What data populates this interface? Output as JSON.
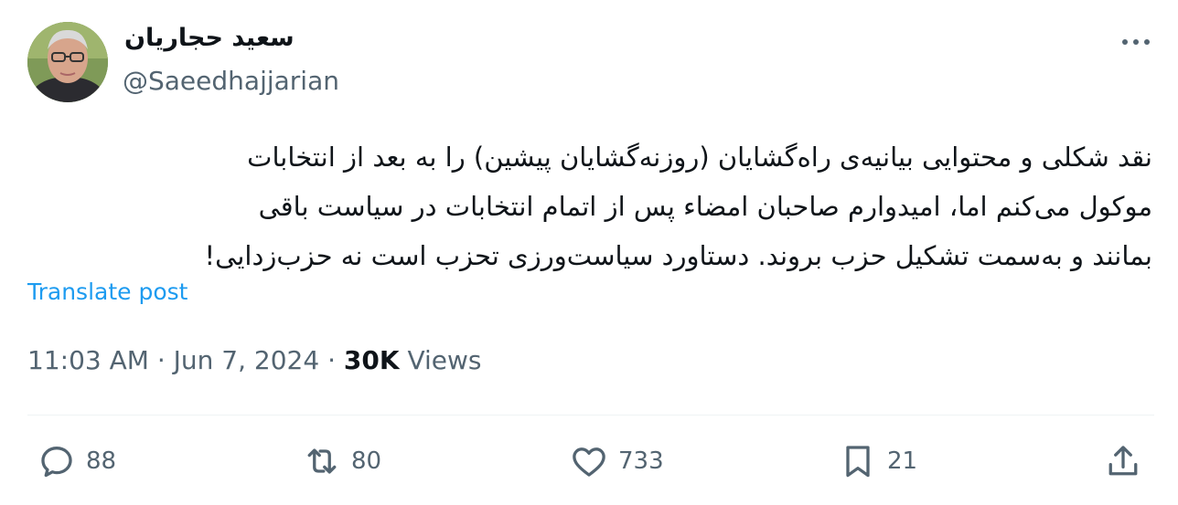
{
  "author": {
    "display_name": "سعید حجاریان",
    "handle": "@Saeedhajjarian"
  },
  "tweet": {
    "lines": [
      "نقد شکلی و محتوایی بیانیه‌ی راه‌گشایان (روزنه‌گشایان پیشین) را به بعد از انتخابات",
      "موکول می‌کنم اما، امیدوارم صاحبان امضاء پس از اتمام انتخابات در سیاست باقی",
      "بمانند و به‌سمت تشکیل حزب بروند. دستاورد سیاست‌ورزی تحزب است نه حزب‌زدایی!"
    ],
    "translate_label": "Translate post"
  },
  "meta": {
    "time": "11:03 AM",
    "date": "Jun 7, 2024",
    "separator": "·",
    "views_count": "30K",
    "views_label": "Views"
  },
  "actions": {
    "replies": "88",
    "reposts": "80",
    "likes": "733",
    "bookmarks": "21"
  },
  "icons": {
    "more": "more-icon",
    "reply": "reply-icon",
    "repost": "repost-icon",
    "like": "like-icon",
    "bookmark": "bookmark-icon",
    "share": "share-icon"
  },
  "colors": {
    "text": "#0f1419",
    "secondary": "#536471",
    "link": "#1d9bf0",
    "divider": "#eff3f4"
  }
}
